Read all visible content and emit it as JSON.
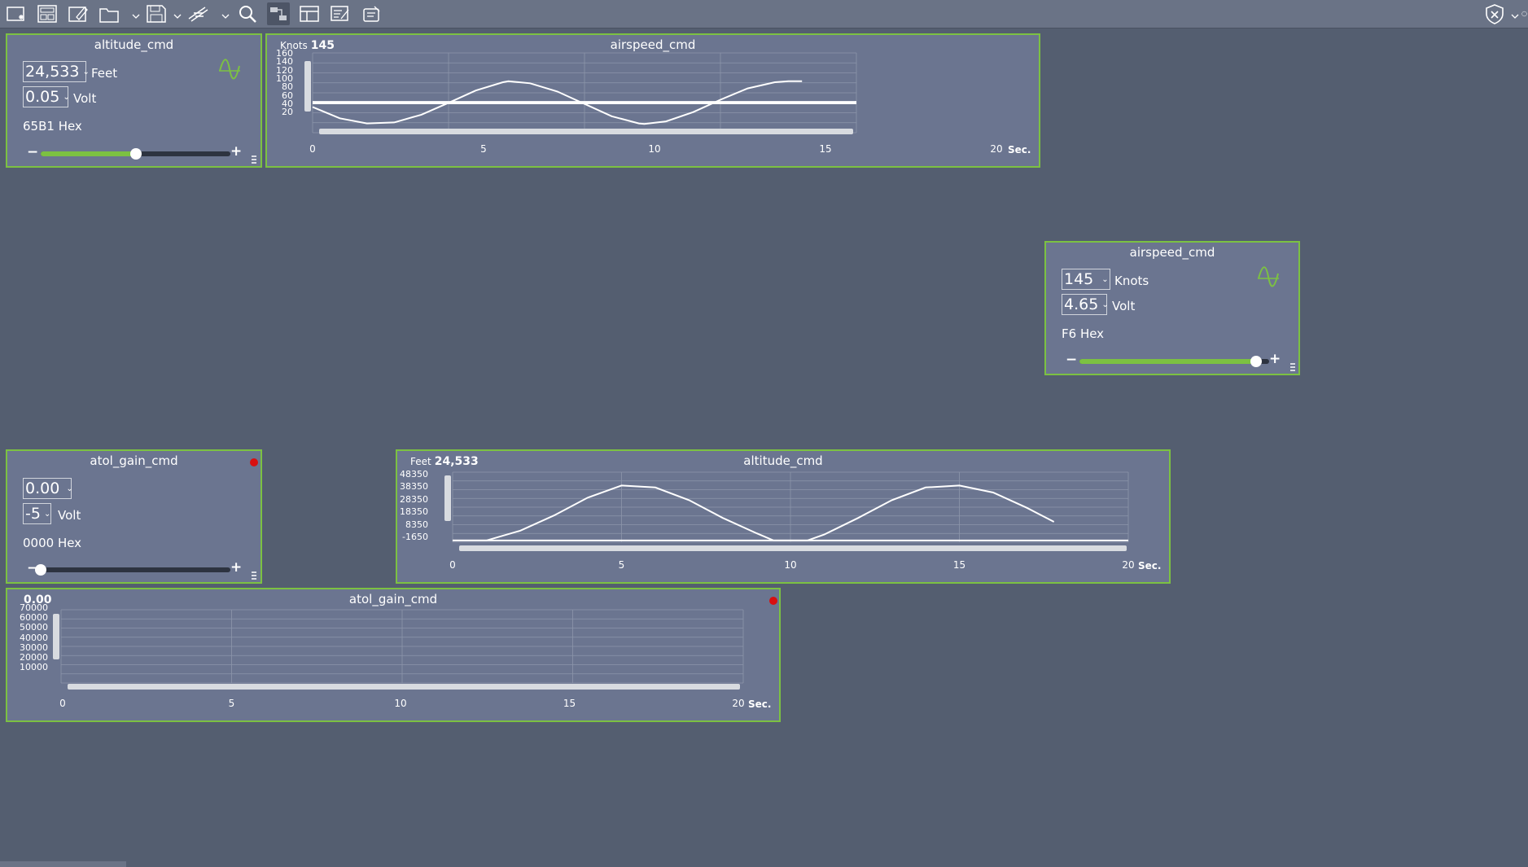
{
  "toolbar": {
    "buttons": [
      "new-panel-icon",
      "layout-icon",
      "edit-icon",
      "open-folder-icon",
      "save-icon",
      "script-icon",
      "search-icon",
      "connect-icon",
      "table-icon",
      "edit-list-icon",
      "export-icon"
    ],
    "right_icon": "shield-icon"
  },
  "widgets": {
    "altitude_control": {
      "title": "altitude_cmd",
      "value": "24,533",
      "unit": "Feet",
      "volt_value": "0.05",
      "volt_unit": "Volt",
      "hex": "65B1 Hex",
      "slider_fraction": 0.5,
      "minus": "−",
      "plus": "+"
    },
    "airspeed_control": {
      "title": "airspeed_cmd",
      "value": "145",
      "unit": "Knots",
      "volt_value": "4.65",
      "volt_unit": "Volt",
      "hex": "F6 Hex",
      "slider_fraction": 0.93,
      "minus": "−",
      "plus": "+"
    },
    "atol_control": {
      "title": "atol_gain_cmd",
      "value": "0.00",
      "volt_value": "-5",
      "volt_unit": "Volt",
      "hex": "0000 Hex",
      "slider_fraction": 0.0,
      "minus": "−",
      "plus": "+"
    }
  },
  "charts": {
    "airspeed_chart": {
      "title": "airspeed_cmd",
      "readout_unit": "Knots",
      "readout_value": "145",
      "y_ticks": [
        "160",
        "140",
        "120",
        "100",
        "80",
        "60",
        "40",
        "20"
      ],
      "x_ticks": [
        "0",
        "5",
        "10",
        "15",
        "20"
      ],
      "x_unit": "Sec."
    },
    "altitude_chart": {
      "title": "altitude_cmd",
      "readout_unit": "Feet",
      "readout_value": "24,533",
      "y_ticks": [
        "48350",
        "38350",
        "28350",
        "18350",
        "8350",
        "-1650"
      ],
      "x_ticks": [
        "0",
        "5",
        "10",
        "15",
        "20"
      ],
      "x_unit": "Sec."
    },
    "atol_chart": {
      "title": "atol_gain_cmd",
      "readout_unit": "",
      "readout_value": "0.00",
      "y_ticks": [
        "70000",
        "60000",
        "50000",
        "40000",
        "30000",
        "20000",
        "10000"
      ],
      "x_ticks": [
        "0",
        "5",
        "10",
        "15",
        "20"
      ],
      "x_unit": "Sec."
    }
  },
  "chart_data": [
    {
      "type": "line",
      "title": "airspeed_cmd",
      "ylabel": "Knots",
      "xlabel": "Sec.",
      "xlim": [
        0,
        20
      ],
      "ylim": [
        10,
        165
      ],
      "series": [
        {
          "x": [
            0,
            1,
            2,
            3,
            4,
            5,
            6,
            7,
            7.2,
            8,
            9,
            10,
            11,
            12,
            12.2,
            13,
            14,
            15,
            16,
            17,
            17.5,
            18
          ],
          "values": [
            60,
            38,
            28,
            30,
            45,
            68,
            92,
            108,
            110,
            106,
            90,
            66,
            42,
            28,
            27,
            32,
            50,
            74,
            96,
            108,
            110,
            110
          ]
        }
      ],
      "reference_values": [
        70,
        67
      ]
    },
    {
      "type": "line",
      "title": "altitude_cmd",
      "ylabel": "Feet",
      "xlabel": "Sec.",
      "xlim": [
        0,
        20
      ],
      "ylim": [
        -3000,
        52000
      ],
      "series": [
        {
          "x": [
            0,
            1,
            2,
            3,
            4,
            5,
            6,
            7,
            8,
            9,
            9.5,
            10,
            10.5,
            11,
            12,
            13,
            14,
            15,
            16,
            17,
            17.8
          ],
          "values": [
            -1650,
            -1650,
            6000,
            18000,
            32000,
            41500,
            40000,
            30000,
            16000,
            4000,
            -1650,
            -1650,
            -1650,
            3000,
            16000,
            30000,
            40000,
            41500,
            36000,
            24000,
            13000
          ]
        }
      ],
      "reference_values": [
        -1650
      ]
    },
    {
      "type": "line",
      "title": "atol_gain_cmd",
      "xlabel": "Sec.",
      "xlim": [
        0,
        20
      ],
      "ylim": [
        5000,
        75000
      ],
      "series": []
    }
  ],
  "colors": {
    "background": "#545e70",
    "panel": "#6b7590",
    "accent_green": "#7cc142",
    "alert_red": "#d81010"
  }
}
